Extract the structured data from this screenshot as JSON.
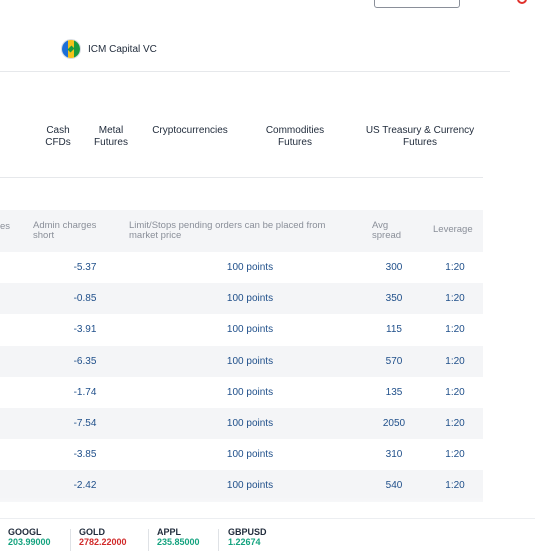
{
  "entity": {
    "name": "ICM Capital VC"
  },
  "tabs": [
    {
      "line1": "Cash",
      "line2": "CFDs"
    },
    {
      "line1": "Metal",
      "line2": "Futures"
    },
    {
      "line1": "Cryptocurrencies",
      "line2": ""
    },
    {
      "line1": "Commodities",
      "line2": "Futures"
    },
    {
      "line1": "US Treasury & Currency",
      "line2": "Futures"
    }
  ],
  "table": {
    "headers": {
      "prev_clip": "es",
      "admin_short": "Admin charges short",
      "limit_stops": "Limit/Stops pending orders can be placed from market price",
      "avg_spread": "Avg spread",
      "leverage": "Leverage"
    },
    "rows": [
      {
        "admin_short": "-5.37",
        "limit_stops": "100 points",
        "avg_spread": "300",
        "leverage": "1:20"
      },
      {
        "admin_short": "-0.85",
        "limit_stops": "100 points",
        "avg_spread": "350",
        "leverage": "1:20"
      },
      {
        "admin_short": "-3.91",
        "limit_stops": "100 points",
        "avg_spread": "115",
        "leverage": "1:20"
      },
      {
        "admin_short": "-6.35",
        "limit_stops": "100 points",
        "avg_spread": "570",
        "leverage": "1:20"
      },
      {
        "admin_short": "-1.74",
        "limit_stops": "100 points",
        "avg_spread": "135",
        "leverage": "1:20"
      },
      {
        "admin_short": "-7.54",
        "limit_stops": "100 points",
        "avg_spread": "2050",
        "leverage": "1:20"
      },
      {
        "admin_short": "-3.85",
        "limit_stops": "100 points",
        "avg_spread": "310",
        "leverage": "1:20"
      },
      {
        "admin_short": "-2.42",
        "limit_stops": "100 points",
        "avg_spread": "540",
        "leverage": "1:20"
      }
    ]
  },
  "ticker": [
    {
      "symbol": "GOOGL",
      "value": "203.99000",
      "trend": "up"
    },
    {
      "symbol": "GOLD",
      "value": "2782.22000",
      "trend": "down"
    },
    {
      "symbol": "APPL",
      "value": "235.85000",
      "trend": "up"
    },
    {
      "symbol": "GBPUSD",
      "value": "1.22674",
      "trend": "up"
    }
  ],
  "colors": {
    "accent": "#1f4f8a",
    "up": "#14a37f",
    "down": "#d12a2a",
    "row_alt": "#f4f5f7"
  }
}
